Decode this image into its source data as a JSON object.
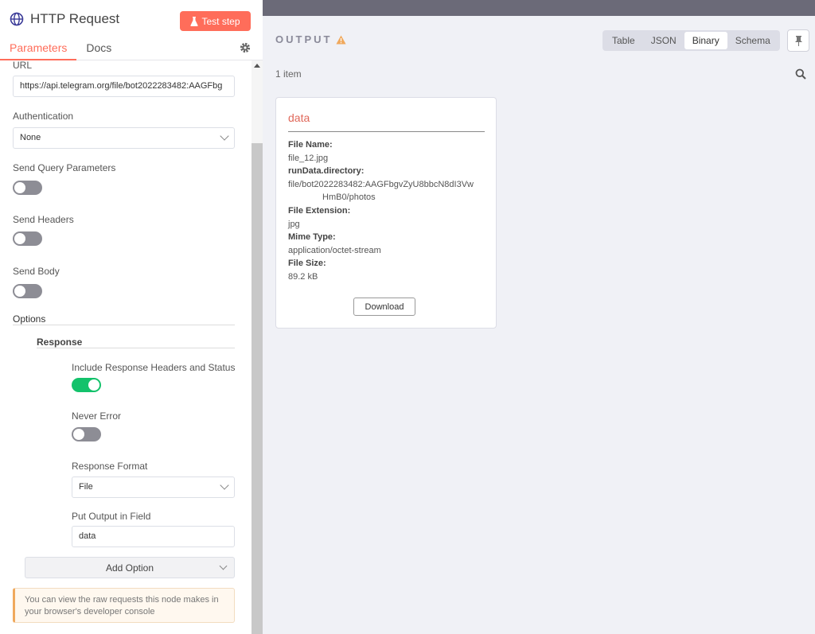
{
  "node": {
    "title": "HTTP Request",
    "test_step": "Test step",
    "tabs": [
      "Parameters",
      "Docs"
    ]
  },
  "params": {
    "url_label": "URL",
    "url_value": "https://api.telegram.org/file/bot2022283482:AAGFbg",
    "auth_label": "Authentication",
    "auth_value": "None",
    "query_label": "Send Query Parameters",
    "headers_label": "Send Headers",
    "body_label": "Send Body",
    "options_label": "Options",
    "response_label": "Response",
    "include_headers_label": "Include Response Headers and Status",
    "include_headers_on": true,
    "never_error_label": "Never Error",
    "never_error_on": false,
    "format_label": "Response Format",
    "format_value": "File",
    "output_field_label": "Put Output in Field",
    "output_field_value": "data",
    "add_option": "Add Option",
    "notice": "You can view the raw requests this node makes in your browser's developer console"
  },
  "output": {
    "title": "OUTPUT",
    "views": [
      "Table",
      "JSON",
      "Binary",
      "Schema"
    ],
    "active_view": "Binary",
    "item_count": "1 item",
    "card": {
      "title": "data",
      "file_name_key": "File Name:",
      "file_name": "file_12.jpg",
      "directory_key": "runData.directory:",
      "directory_line1": "file/bot2022283482:AAGFbgvZyU8bbcN8dI3Vw",
      "directory_line2": "HmB0/photos",
      "ext_key": "File Extension:",
      "ext": "jpg",
      "mime_key": "Mime Type:",
      "mime": "application/octet-stream",
      "size_key": "File Size:",
      "size": "89.2 kB",
      "download": "Download"
    }
  },
  "colors": {
    "accent": "#ff6d5a",
    "toggle_on": "#13c26b",
    "toggle_off": "#8d8d95",
    "warning": "#f0a95d"
  }
}
